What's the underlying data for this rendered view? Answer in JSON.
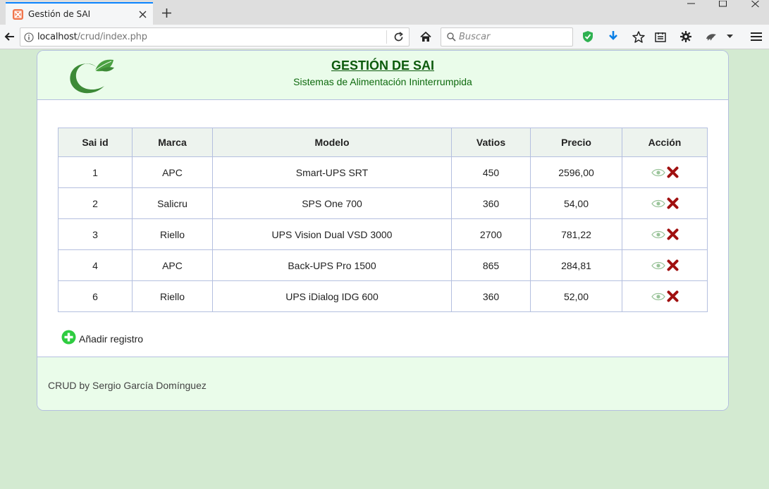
{
  "browser": {
    "tab_title": "Gestión de SAI",
    "url_host": "localhost",
    "url_path": "/crud/index.php",
    "search_placeholder": "Buscar"
  },
  "header": {
    "title": "GESTIÓN DE SAI",
    "subtitle": "Sistemas de Alimentación Ininterrumpida"
  },
  "table": {
    "columns": [
      "Sai id",
      "Marca",
      "Modelo",
      "Vatios",
      "Precio",
      "Acción"
    ],
    "rows": [
      [
        "1",
        "APC",
        "Smart-UPS SRT",
        "450",
        "2596,00"
      ],
      [
        "2",
        "Salicru",
        "SPS One 700",
        "360",
        "54,00"
      ],
      [
        "3",
        "Riello",
        "UPS Vision Dual VSD 3000",
        "2700",
        "781,22"
      ],
      [
        "4",
        "APC",
        "Back-UPS Pro 1500",
        "865",
        "284,81"
      ],
      [
        "6",
        "Riello",
        "UPS iDialog IDG 600",
        "360",
        "52,00"
      ]
    ]
  },
  "add_record_label": "Añadir registro",
  "footer": {
    "text": "CRUD by Sergio García Domínguez"
  },
  "colors": {
    "page_bg": "#d3ead1",
    "header_bg": "#eafcea",
    "title_green": "#0c5a0c",
    "delete_red": "#a01010",
    "add_green": "#2ecc40"
  }
}
